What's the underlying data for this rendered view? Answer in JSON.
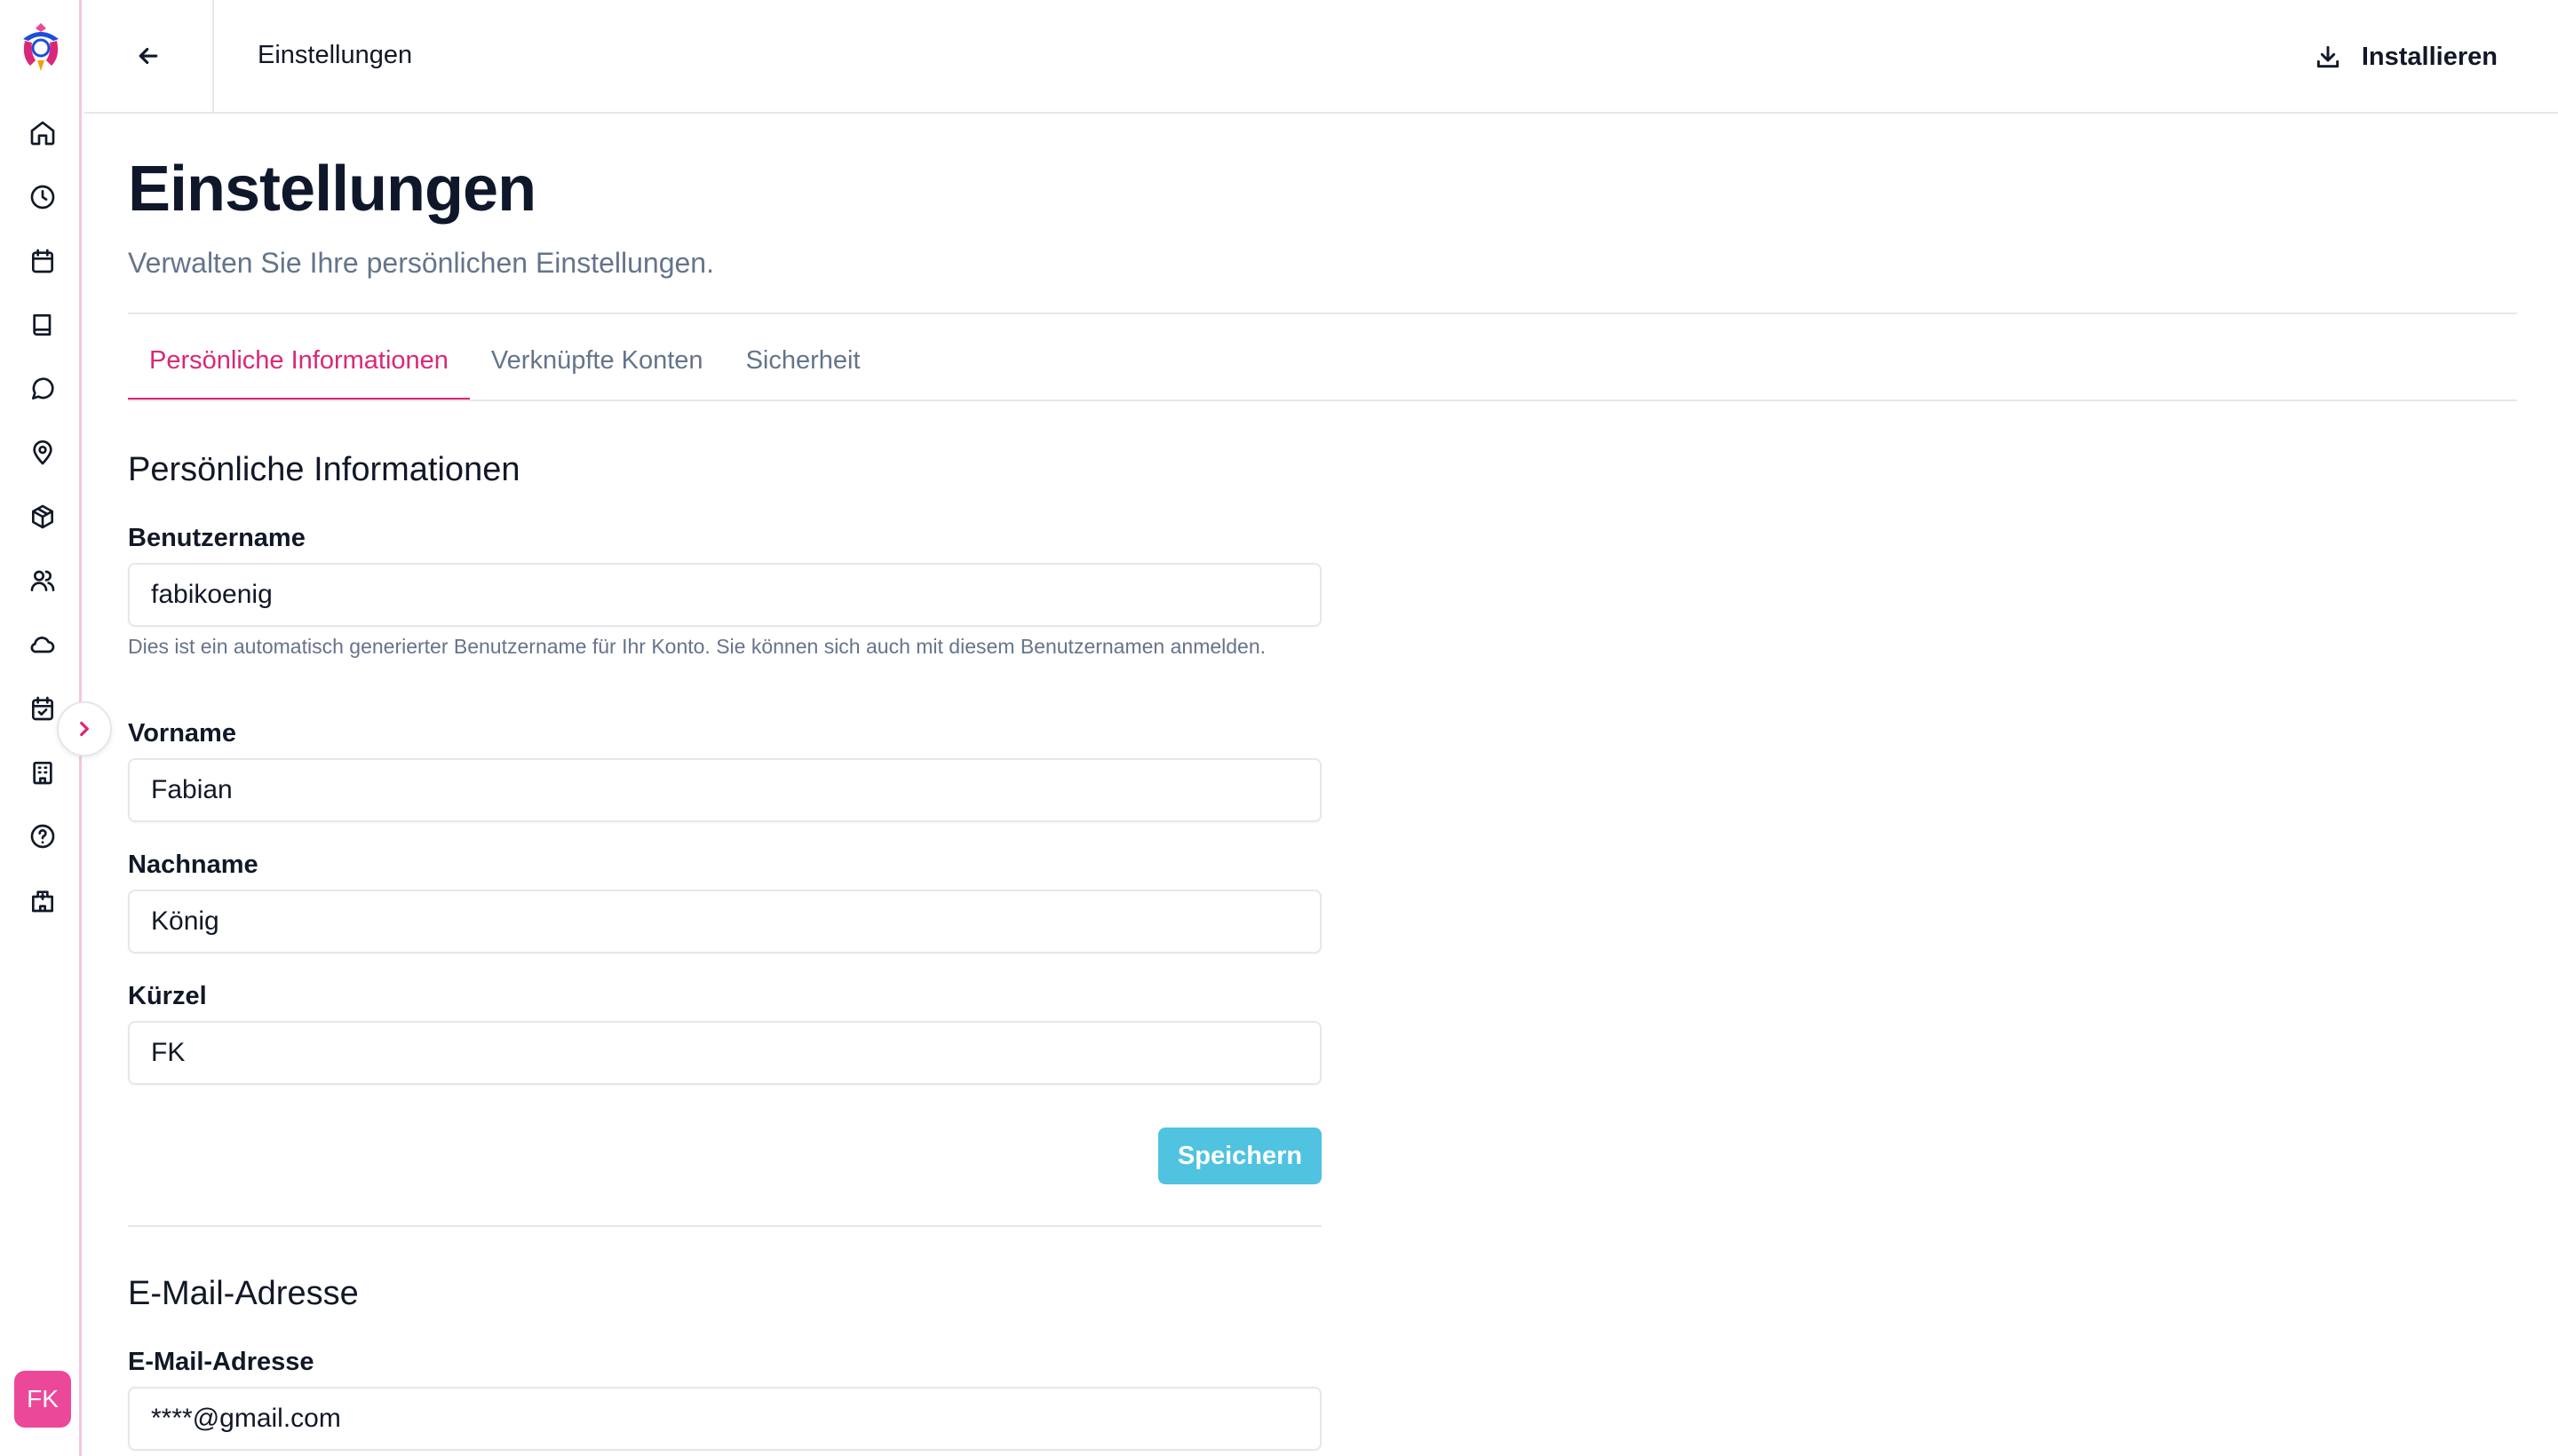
{
  "header": {
    "title": "Einstellungen",
    "install_label": "Installieren"
  },
  "sidebar": {
    "items": [
      {
        "icon": "home-icon"
      },
      {
        "icon": "clock-icon"
      },
      {
        "icon": "calendar-icon"
      },
      {
        "icon": "book-icon"
      },
      {
        "icon": "message-circle-icon"
      },
      {
        "icon": "map-pin-icon"
      },
      {
        "icon": "package-icon"
      },
      {
        "icon": "users-icon"
      },
      {
        "icon": "cloud-icon"
      },
      {
        "icon": "calendar-check-icon"
      },
      {
        "icon": "building-icon"
      },
      {
        "icon": "help-circle-icon"
      },
      {
        "icon": "hospital-icon"
      }
    ],
    "avatar_initials": "FK"
  },
  "page": {
    "title": "Einstellungen",
    "subtitle": "Verwalten Sie Ihre persönlichen Einstellungen."
  },
  "tabs": [
    {
      "label": "Persönliche Informationen",
      "active": true
    },
    {
      "label": "Verknüpfte Konten",
      "active": false
    },
    {
      "label": "Sicherheit",
      "active": false
    }
  ],
  "personal": {
    "section_title": "Persönliche Informationen",
    "username": {
      "label": "Benutzername",
      "value": "fabikoenig",
      "hint": "Dies ist ein automatisch generierter Benutzername für Ihr Konto. Sie können sich auch mit diesem Benutzernamen anmelden."
    },
    "firstname": {
      "label": "Vorname",
      "value": "Fabian"
    },
    "lastname": {
      "label": "Nachname",
      "value": "König"
    },
    "initials": {
      "label": "Kürzel",
      "value": "FK"
    },
    "save_label": "Speichern"
  },
  "email": {
    "section_title": "E-Mail-Adresse",
    "label": "E-Mail-Adresse",
    "value": "****@gmail.com"
  },
  "colors": {
    "accent": "#db2777",
    "save_button": "#4fc3e0",
    "avatar": "#ec4899"
  }
}
